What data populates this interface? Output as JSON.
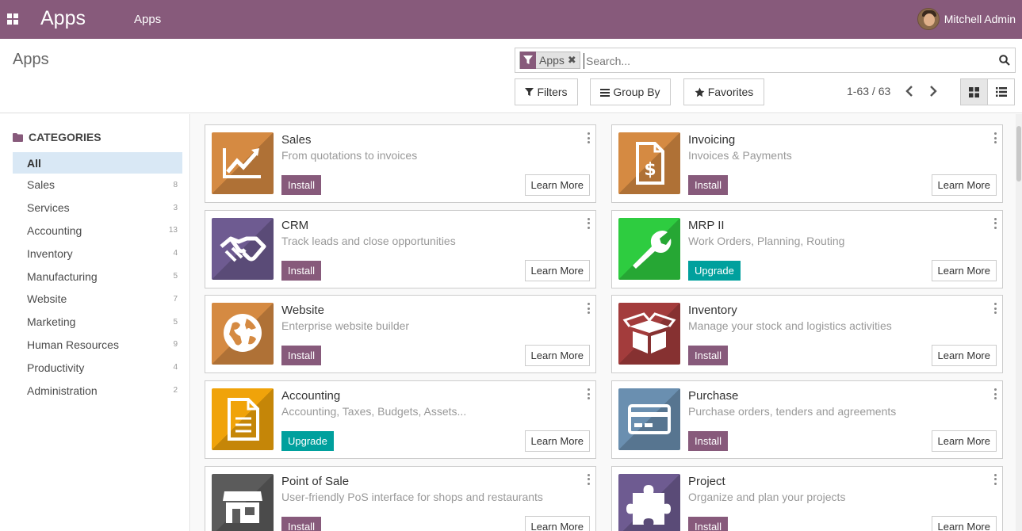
{
  "navbar": {
    "brand": "Apps",
    "menu": [
      "Apps"
    ],
    "user_name": "Mitchell Admin",
    "color": "#875a7b"
  },
  "control_panel": {
    "title": "Apps",
    "search": {
      "facet_label": "Apps",
      "placeholder": "Search..."
    },
    "filters_label": "Filters",
    "group_by_label": "Group By",
    "favorites_label": "Favorites",
    "pager": "1-63 / 63"
  },
  "sidebar": {
    "header": "CATEGORIES",
    "items": [
      {
        "label": "All",
        "count": ""
      },
      {
        "label": "Sales",
        "count": "8"
      },
      {
        "label": "Services",
        "count": "3"
      },
      {
        "label": "Accounting",
        "count": "13"
      },
      {
        "label": "Inventory",
        "count": "4"
      },
      {
        "label": "Manufacturing",
        "count": "5"
      },
      {
        "label": "Website",
        "count": "7"
      },
      {
        "label": "Marketing",
        "count": "5"
      },
      {
        "label": "Human Resources",
        "count": "9"
      },
      {
        "label": "Productivity",
        "count": "4"
      },
      {
        "label": "Administration",
        "count": "2"
      }
    ]
  },
  "apps": [
    {
      "name": "Sales",
      "desc": "From quotations to invoices",
      "action": "Install",
      "icon": "chart-trend-icon",
      "color": "#d58a42",
      "learn": "Learn More"
    },
    {
      "name": "Invoicing",
      "desc": "Invoices & Payments",
      "action": "Install",
      "icon": "invoice-dollar-icon",
      "color": "#d58a42",
      "learn": "Learn More"
    },
    {
      "name": "CRM",
      "desc": "Track leads and close opportunities",
      "action": "Install",
      "icon": "handshake-icon",
      "color": "#6e5b91",
      "learn": "Learn More"
    },
    {
      "name": "MRP II",
      "desc": "Work Orders, Planning, Routing",
      "action": "Upgrade",
      "icon": "wrench-icon",
      "color": "#2ecc40",
      "learn": "Learn More"
    },
    {
      "name": "Website",
      "desc": "Enterprise website builder",
      "action": "Install",
      "icon": "globe-icon",
      "color": "#d58a42",
      "learn": "Learn More"
    },
    {
      "name": "Inventory",
      "desc": "Manage your stock and logistics activities",
      "action": "Install",
      "icon": "box-open-icon",
      "color": "#a33c3c",
      "learn": "Learn More"
    },
    {
      "name": "Accounting",
      "desc": "Accounting, Taxes, Budgets, Assets...",
      "action": "Upgrade",
      "icon": "document-icon",
      "color": "#f0a30a",
      "learn": "Learn More"
    },
    {
      "name": "Purchase",
      "desc": "Purchase orders, tenders and agreements",
      "action": "Install",
      "icon": "credit-card-icon",
      "color": "#6a8fb0",
      "learn": "Learn More"
    },
    {
      "name": "Point of Sale",
      "desc": "User-friendly PoS interface for shops and restaurants",
      "action": "Install",
      "icon": "shop-icon",
      "color": "#5b5b5b",
      "learn": "Learn More"
    },
    {
      "name": "Project",
      "desc": "Organize and plan your projects",
      "action": "Install",
      "icon": "puzzle-icon",
      "color": "#6e5b91",
      "learn": "Learn More"
    }
  ]
}
